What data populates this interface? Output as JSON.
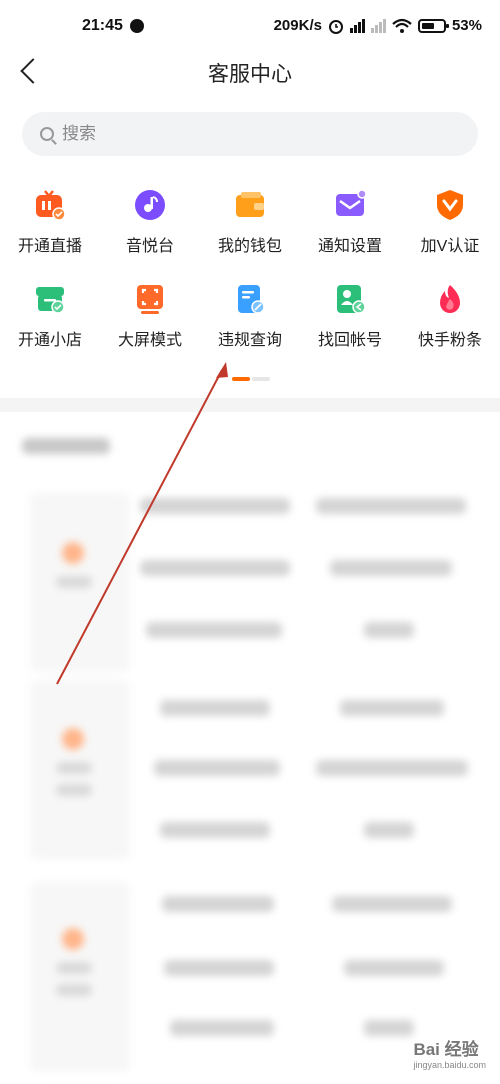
{
  "status_bar": {
    "time": "21:45",
    "net_speed": "209K/s",
    "battery": "53%"
  },
  "header": {
    "title": "客服中心",
    "back_icon": "chevron-left-icon"
  },
  "search": {
    "placeholder": "搜索",
    "icon": "search-icon"
  },
  "services": [
    {
      "label": "开通直播",
      "icon": "live-icon",
      "color": "#ff5a1f"
    },
    {
      "label": "音悦台",
      "icon": "music-icon",
      "color": "#7b4dff"
    },
    {
      "label": "我的钱包",
      "icon": "wallet-icon",
      "color": "#ff9f1a"
    },
    {
      "label": "通知设置",
      "icon": "mail-icon",
      "color": "#8a5cff"
    },
    {
      "label": "加V认证",
      "icon": "shield-v-icon",
      "color": "#ff6a00"
    },
    {
      "label": "开通小店",
      "icon": "store-icon",
      "color": "#2bbf7a"
    },
    {
      "label": "大屏模式",
      "icon": "fullscreen-icon",
      "color": "#ff6a2a"
    },
    {
      "label": "违规查询",
      "icon": "document-check-icon",
      "color": "#3aa0ff"
    },
    {
      "label": "找回帐号",
      "icon": "user-recover-icon",
      "color": "#2bbf7a"
    },
    {
      "label": "快手粉条",
      "icon": "flame-icon",
      "color": "#ff2d55"
    }
  ],
  "watermark": {
    "brand": "Bai 经验",
    "url": "jingyan.baidu.com"
  },
  "colors": {
    "accent": "#ff6a00",
    "annotation_arrow": "#c0392b"
  }
}
